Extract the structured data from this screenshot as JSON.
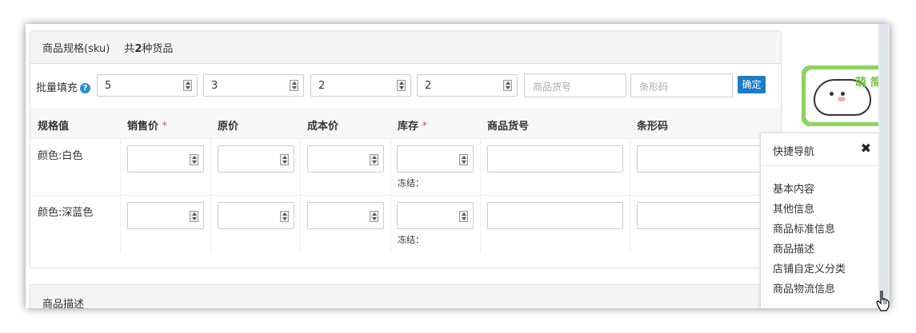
{
  "panel": {
    "sku_label": "商品规格(sku)",
    "count_prefix": "共",
    "count": "2",
    "count_suffix": "种货品"
  },
  "batch": {
    "label": "批量填充",
    "help_icon": "?",
    "values": [
      "5",
      "3",
      "2",
      "2"
    ],
    "sku_placeholder": "商品货号",
    "barcode_placeholder": "条形码",
    "confirm": "确定"
  },
  "table": {
    "headers": [
      "规格值",
      "销售价",
      "原价",
      "成本价",
      "库存",
      "商品货号",
      "条形码"
    ],
    "required_mark": "*",
    "rows": [
      {
        "spec": "颜色:白色",
        "freeze": "冻结："
      },
      {
        "spec": "颜色:深蓝色",
        "freeze": "冻结："
      }
    ]
  },
  "section2": {
    "title": "商品描述"
  },
  "sticker": {
    "text": "萌 简"
  },
  "quick_nav": {
    "title": "快捷导航",
    "close": "✖",
    "items": [
      "基本内容",
      "其他信息",
      "商品标准信息",
      "商品描述",
      "店铺自定义分类",
      "商品物流信息"
    ]
  },
  "colors": {
    "primary": "#1a7bc9",
    "help": "#2a8fd4",
    "required": "#d9534f",
    "sticker_green": "#8dd35f"
  }
}
